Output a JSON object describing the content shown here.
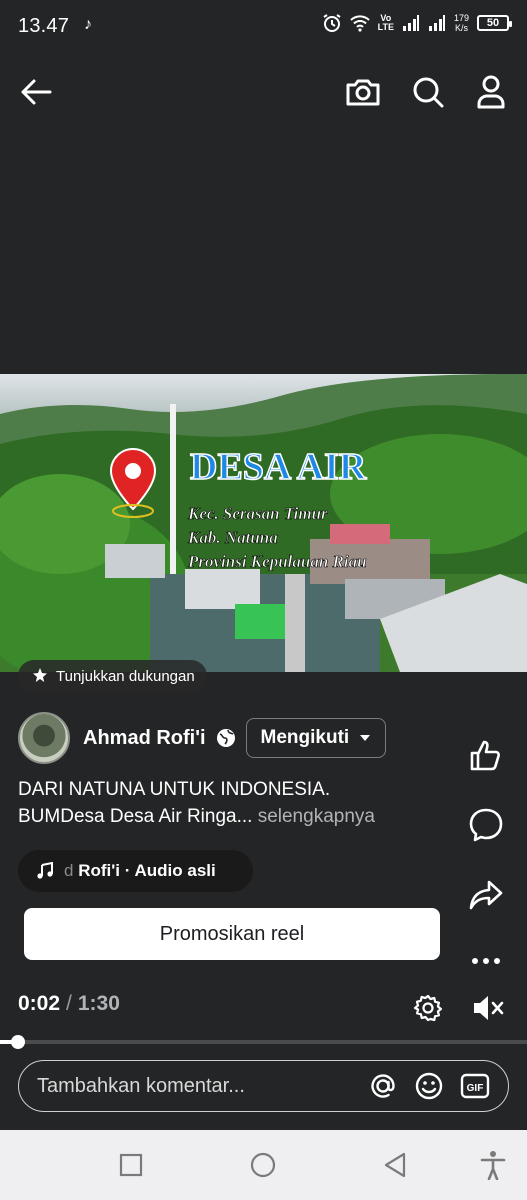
{
  "status_bar": {
    "time": "13.47",
    "network_volte": "Vo\nLTE",
    "speed_value": "179",
    "speed_unit": "K/s",
    "battery": "50"
  },
  "top_bar": {
    "icons": [
      "back-arrow-icon",
      "camera-icon",
      "search-icon",
      "profile-icon"
    ]
  },
  "video": {
    "title_overlay": "DESA AIR",
    "location_lines": [
      "Kec. Serasan Timur",
      "Kab. Natuna",
      "Provinsi Kepulauan Riau"
    ]
  },
  "support_chip": {
    "label": "Tunjukkan dukungan"
  },
  "author": {
    "name": "Ahmad Rofi'i",
    "follow_label": "Mengikuti"
  },
  "caption": {
    "line1": "DARI NATUNA UNTUK INDONESIA.",
    "line2": "BUMDesa Desa  Air Ringa...",
    "more": "selengkapnya"
  },
  "audio": {
    "fade_text": "d",
    "label": "Rofi'i · Audio asli"
  },
  "promote_button": {
    "label": "Promosikan reel"
  },
  "side_actions": [
    "like-icon",
    "comment-icon",
    "share-icon",
    "more-icon"
  ],
  "playback": {
    "current": "0:02",
    "separator": "/",
    "duration": "1:30",
    "progress_fraction": 0.022
  },
  "comment": {
    "placeholder": "Tambahkan komentar...",
    "icons": [
      "mention-icon",
      "emoji-icon",
      "gif-icon"
    ],
    "gif_label": "GIF"
  },
  "colors": {
    "background": "#242526",
    "title_blue": "#1e88e5",
    "pin_red": "#e02424",
    "nav_bar": "#efeff1"
  }
}
